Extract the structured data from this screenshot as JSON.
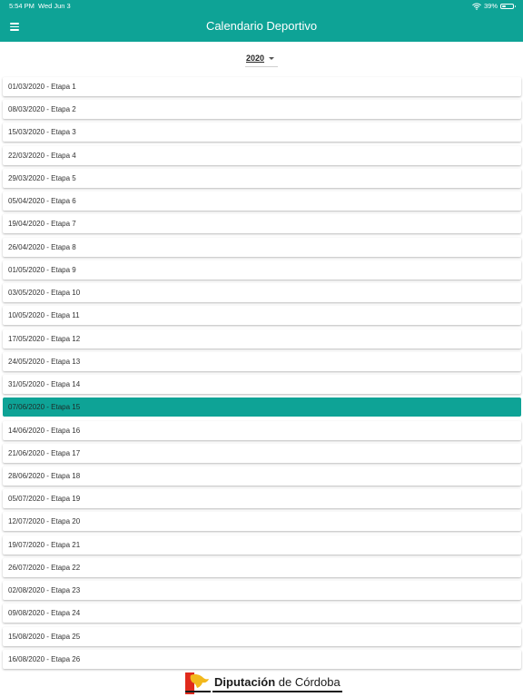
{
  "status_bar": {
    "time": "5:54 PM",
    "date": "Wed Jun 3",
    "battery": "39%",
    "battery_level": 0.39
  },
  "header": {
    "title": "Calendario Deportivo",
    "menu_icon": "hamburger-menu-icon",
    "bg_color": "#0ea396"
  },
  "year_selector": {
    "selected": "2020"
  },
  "stages": [
    "01/03/2020 - Etapa 1",
    "08/03/2020 - Etapa 2",
    "15/03/2020 - Etapa 3",
    "22/03/2020 - Etapa 4",
    "29/03/2020 - Etapa 5",
    "05/04/2020 - Etapa 6",
    "19/04/2020 - Etapa 7",
    "26/04/2020 - Etapa 8",
    "01/05/2020 - Etapa 9",
    "03/05/2020 - Etapa 10",
    "10/05/2020 - Etapa 11",
    "17/05/2020 - Etapa 12",
    "24/05/2020 - Etapa 13",
    "31/05/2020 - Etapa 14",
    "07/06/2020 - Etapa 15",
    "14/06/2020 - Etapa 16",
    "21/06/2020 - Etapa 17",
    "28/06/2020 - Etapa 18",
    "05/07/2020 - Etapa 19",
    "12/07/2020 - Etapa 20",
    "19/07/2020 - Etapa 21",
    "26/07/2020 - Etapa 22",
    "02/08/2020 - Etapa 23",
    "09/08/2020 - Etapa 24",
    "15/08/2020 - Etapa 25",
    "16/08/2020 - Etapa 26"
  ],
  "selected_stage": "07/06/2020 - Etapa 15",
  "footer": {
    "logo_bold": "Diputación",
    "logo_rest": " de Córdoba"
  }
}
